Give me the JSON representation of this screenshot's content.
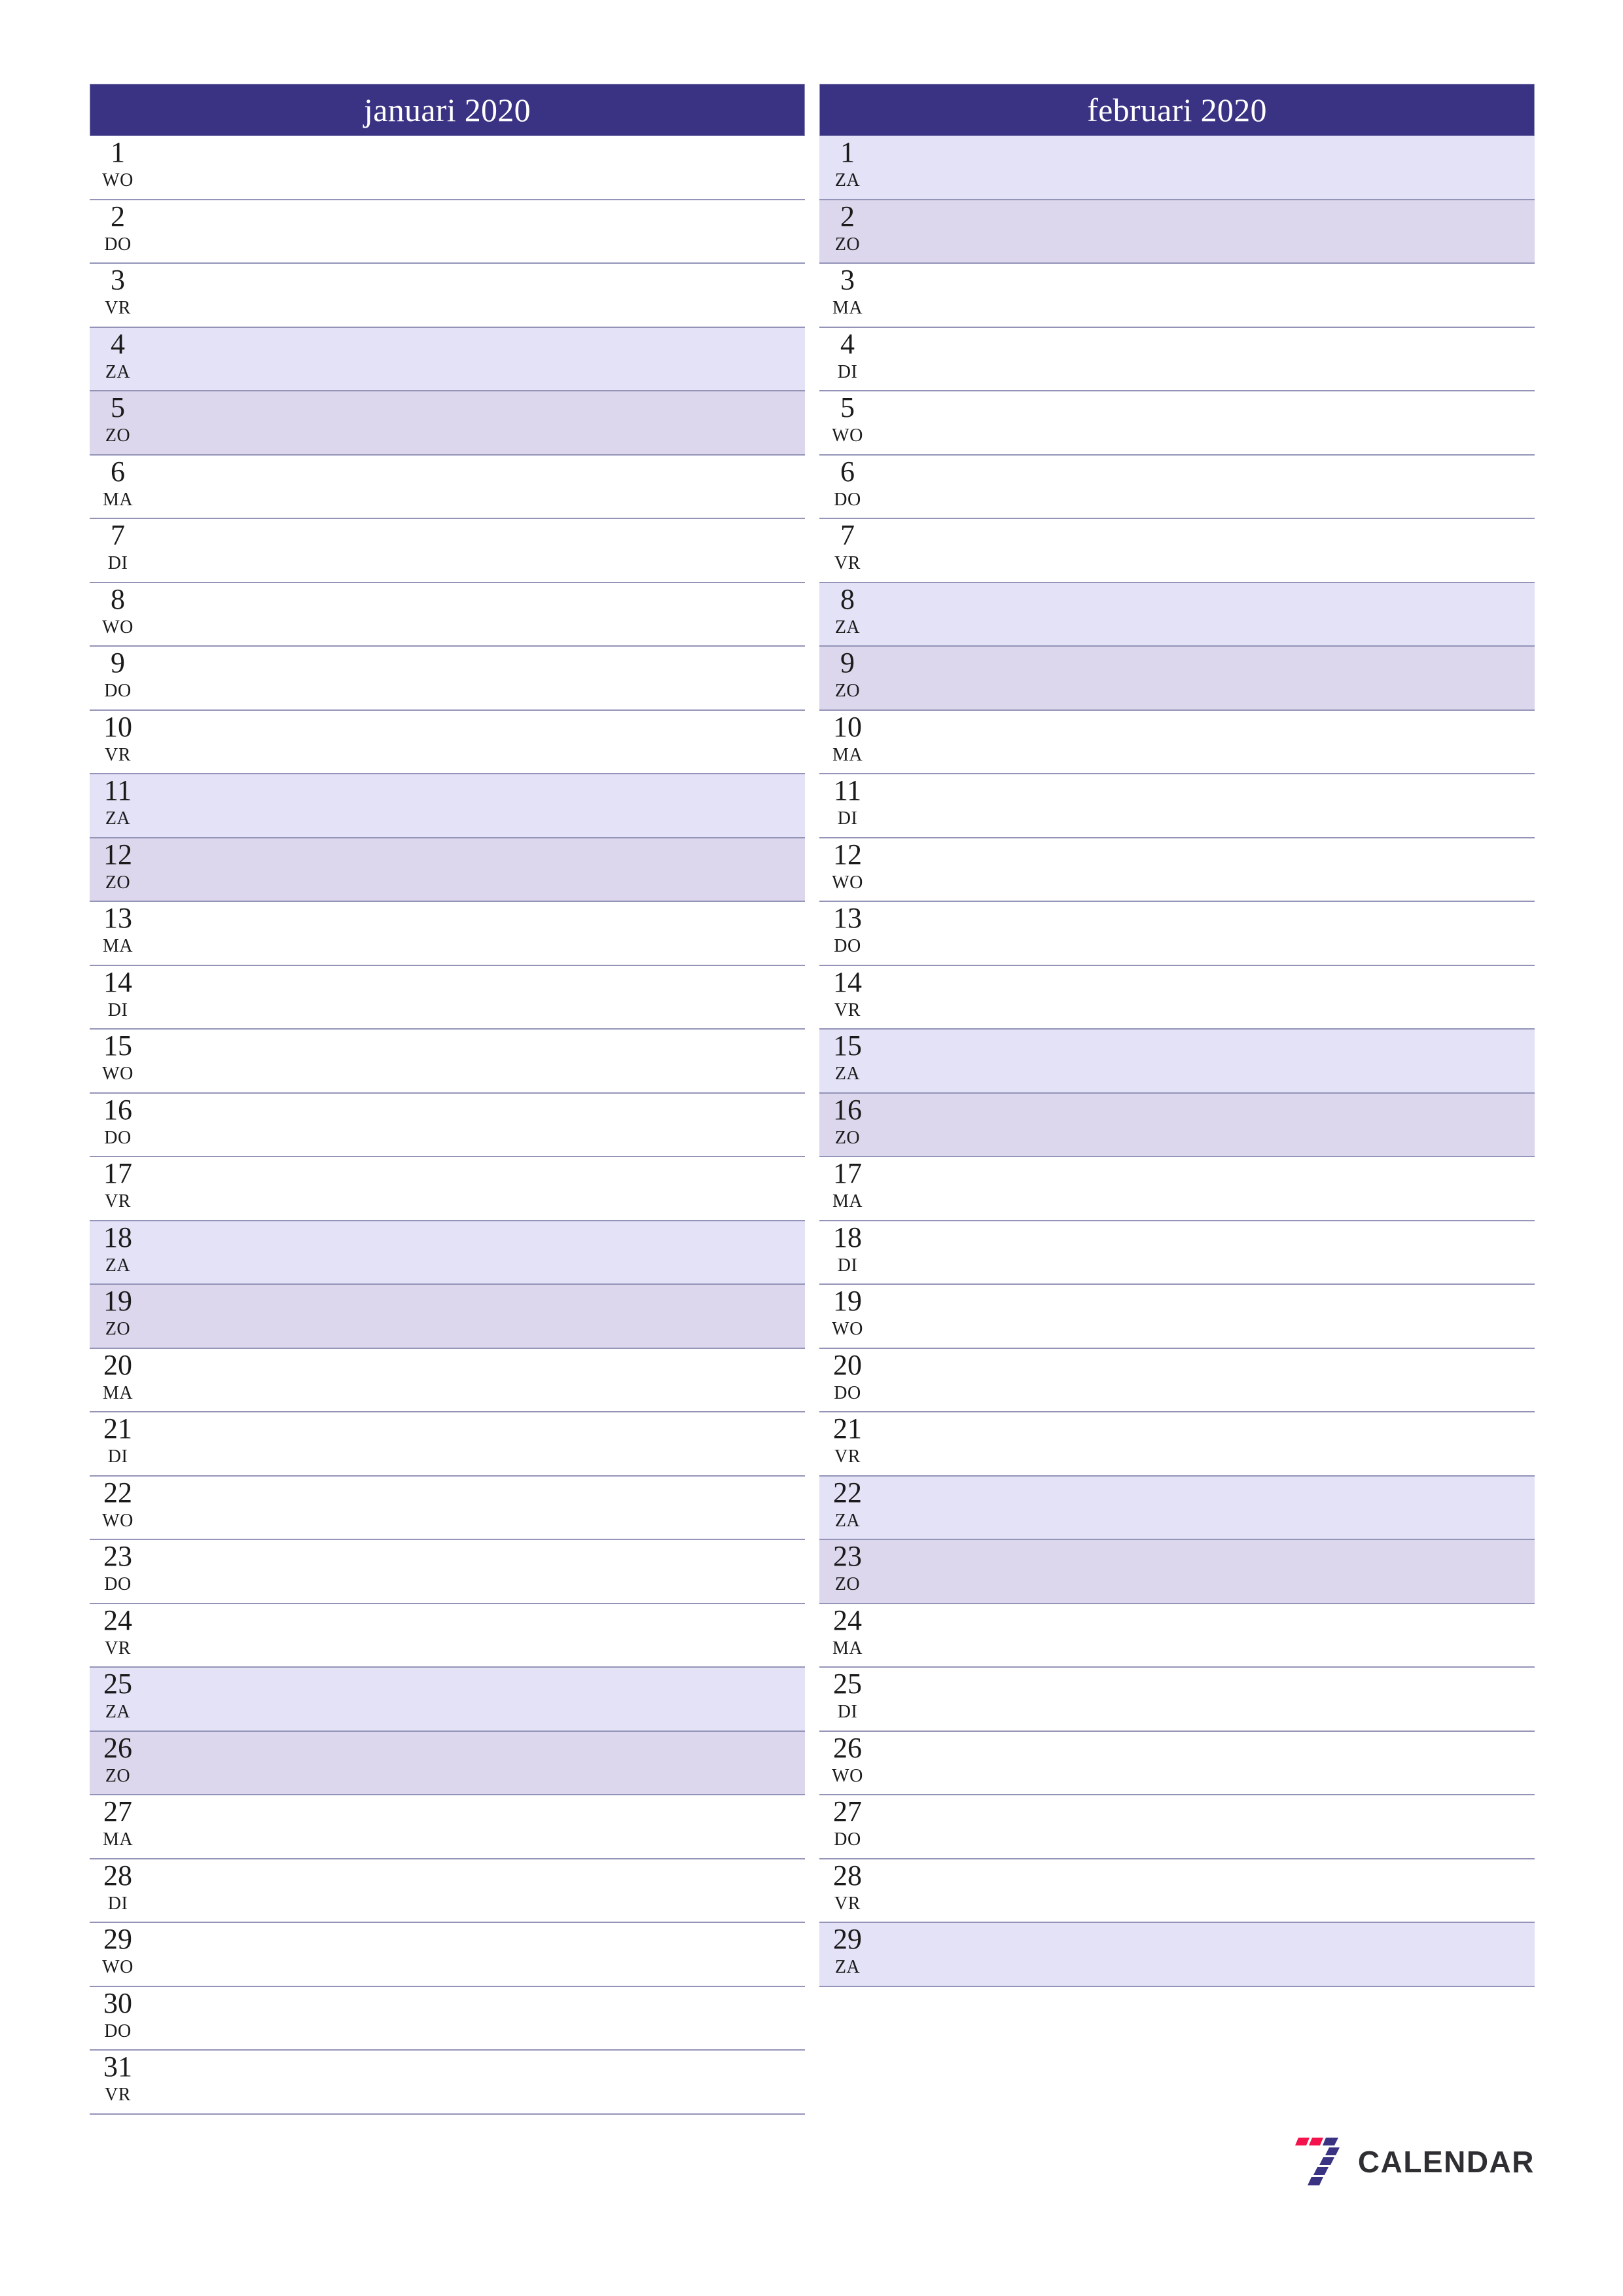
{
  "page": {
    "orientation": "portrait",
    "colors": {
      "header_bg": "#3a3384",
      "header_text": "#ffffff",
      "saturday_bg": "#e3e2f7",
      "sunday_bg": "#dcd7ec",
      "row_border": "#9494b8",
      "page_bg": "#ffffff",
      "logo_red": "#f4134c",
      "logo_blue": "#3a3384",
      "logo_text": "#2f2f33"
    }
  },
  "months": [
    {
      "title": "januari 2020",
      "days": [
        {
          "num": "1",
          "abbr": "WO",
          "type": "weekday"
        },
        {
          "num": "2",
          "abbr": "DO",
          "type": "weekday"
        },
        {
          "num": "3",
          "abbr": "VR",
          "type": "weekday"
        },
        {
          "num": "4",
          "abbr": "ZA",
          "type": "sat"
        },
        {
          "num": "5",
          "abbr": "ZO",
          "type": "sun"
        },
        {
          "num": "6",
          "abbr": "MA",
          "type": "weekday"
        },
        {
          "num": "7",
          "abbr": "DI",
          "type": "weekday"
        },
        {
          "num": "8",
          "abbr": "WO",
          "type": "weekday"
        },
        {
          "num": "9",
          "abbr": "DO",
          "type": "weekday"
        },
        {
          "num": "10",
          "abbr": "VR",
          "type": "weekday"
        },
        {
          "num": "11",
          "abbr": "ZA",
          "type": "sat"
        },
        {
          "num": "12",
          "abbr": "ZO",
          "type": "sun"
        },
        {
          "num": "13",
          "abbr": "MA",
          "type": "weekday"
        },
        {
          "num": "14",
          "abbr": "DI",
          "type": "weekday"
        },
        {
          "num": "15",
          "abbr": "WO",
          "type": "weekday"
        },
        {
          "num": "16",
          "abbr": "DO",
          "type": "weekday"
        },
        {
          "num": "17",
          "abbr": "VR",
          "type": "weekday"
        },
        {
          "num": "18",
          "abbr": "ZA",
          "type": "sat"
        },
        {
          "num": "19",
          "abbr": "ZO",
          "type": "sun"
        },
        {
          "num": "20",
          "abbr": "MA",
          "type": "weekday"
        },
        {
          "num": "21",
          "abbr": "DI",
          "type": "weekday"
        },
        {
          "num": "22",
          "abbr": "WO",
          "type": "weekday"
        },
        {
          "num": "23",
          "abbr": "DO",
          "type": "weekday"
        },
        {
          "num": "24",
          "abbr": "VR",
          "type": "weekday"
        },
        {
          "num": "25",
          "abbr": "ZA",
          "type": "sat"
        },
        {
          "num": "26",
          "abbr": "ZO",
          "type": "sun"
        },
        {
          "num": "27",
          "abbr": "MA",
          "type": "weekday"
        },
        {
          "num": "28",
          "abbr": "DI",
          "type": "weekday"
        },
        {
          "num": "29",
          "abbr": "WO",
          "type": "weekday"
        },
        {
          "num": "30",
          "abbr": "DO",
          "type": "weekday"
        },
        {
          "num": "31",
          "abbr": "VR",
          "type": "weekday"
        }
      ]
    },
    {
      "title": "februari 2020",
      "days": [
        {
          "num": "1",
          "abbr": "ZA",
          "type": "sat"
        },
        {
          "num": "2",
          "abbr": "ZO",
          "type": "sun"
        },
        {
          "num": "3",
          "abbr": "MA",
          "type": "weekday"
        },
        {
          "num": "4",
          "abbr": "DI",
          "type": "weekday"
        },
        {
          "num": "5",
          "abbr": "WO",
          "type": "weekday"
        },
        {
          "num": "6",
          "abbr": "DO",
          "type": "weekday"
        },
        {
          "num": "7",
          "abbr": "VR",
          "type": "weekday"
        },
        {
          "num": "8",
          "abbr": "ZA",
          "type": "sat"
        },
        {
          "num": "9",
          "abbr": "ZO",
          "type": "sun"
        },
        {
          "num": "10",
          "abbr": "MA",
          "type": "weekday"
        },
        {
          "num": "11",
          "abbr": "DI",
          "type": "weekday"
        },
        {
          "num": "12",
          "abbr": "WO",
          "type": "weekday"
        },
        {
          "num": "13",
          "abbr": "DO",
          "type": "weekday"
        },
        {
          "num": "14",
          "abbr": "VR",
          "type": "weekday"
        },
        {
          "num": "15",
          "abbr": "ZA",
          "type": "sat"
        },
        {
          "num": "16",
          "abbr": "ZO",
          "type": "sun"
        },
        {
          "num": "17",
          "abbr": "MA",
          "type": "weekday"
        },
        {
          "num": "18",
          "abbr": "DI",
          "type": "weekday"
        },
        {
          "num": "19",
          "abbr": "WO",
          "type": "weekday"
        },
        {
          "num": "20",
          "abbr": "DO",
          "type": "weekday"
        },
        {
          "num": "21",
          "abbr": "VR",
          "type": "weekday"
        },
        {
          "num": "22",
          "abbr": "ZA",
          "type": "sat"
        },
        {
          "num": "23",
          "abbr": "ZO",
          "type": "sun"
        },
        {
          "num": "24",
          "abbr": "MA",
          "type": "weekday"
        },
        {
          "num": "25",
          "abbr": "DI",
          "type": "weekday"
        },
        {
          "num": "26",
          "abbr": "WO",
          "type": "weekday"
        },
        {
          "num": "27",
          "abbr": "DO",
          "type": "weekday"
        },
        {
          "num": "28",
          "abbr": "VR",
          "type": "weekday"
        },
        {
          "num": "29",
          "abbr": "ZA",
          "type": "sat"
        }
      ]
    }
  ],
  "logo": {
    "mark": "seven-stripes-icon",
    "text": "CALENDAR"
  }
}
